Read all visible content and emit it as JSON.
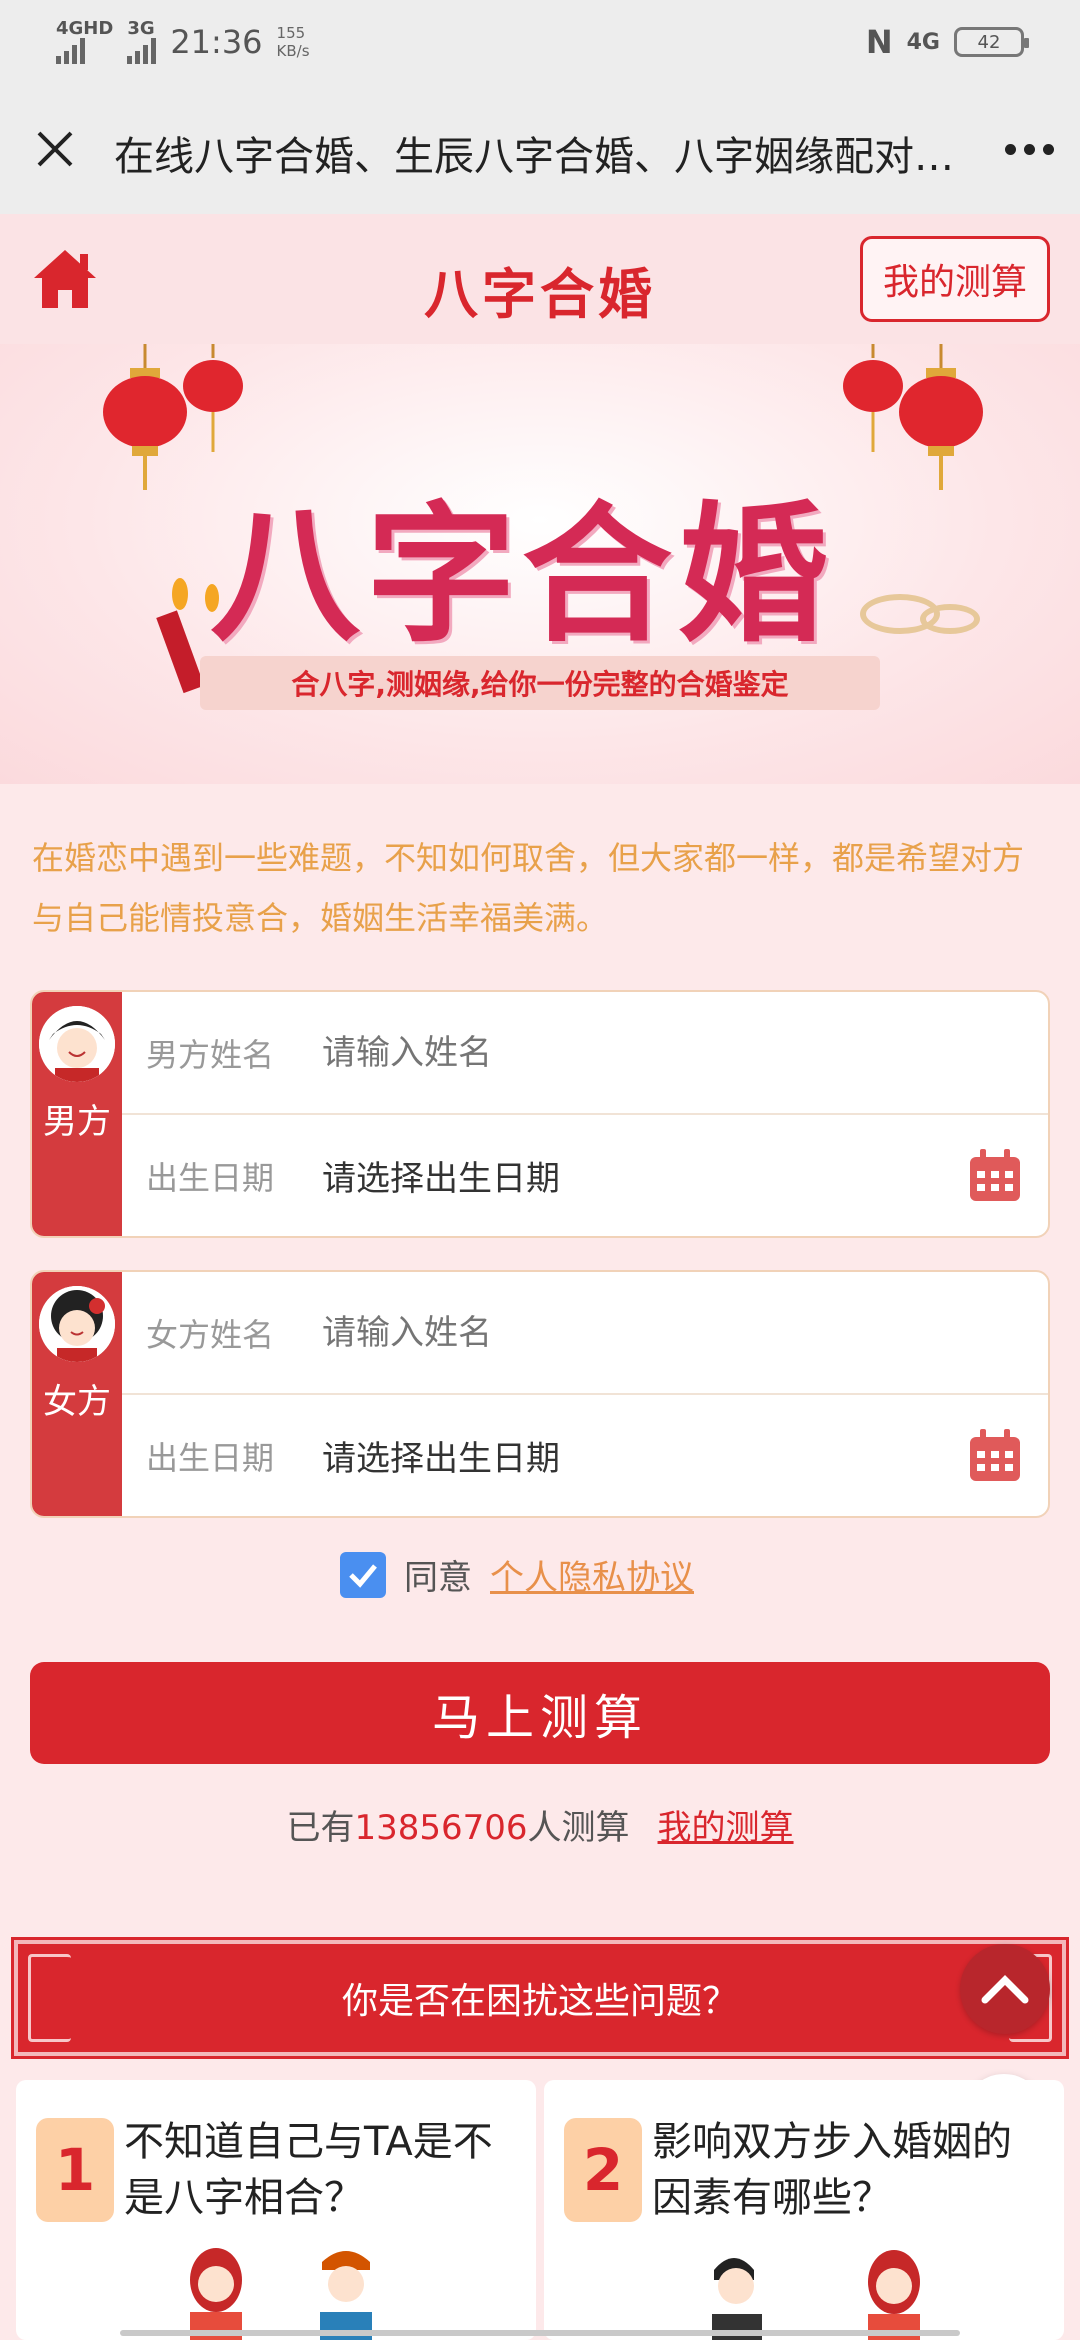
{
  "status_bar": {
    "network_1": "4GHD",
    "network_2": "3G",
    "time": "21:36",
    "speed_value": "155",
    "speed_unit": "KB/s",
    "nfc": "N",
    "network_right": "4G",
    "battery": "42"
  },
  "browser": {
    "title": "在线八字合婚、生辰八字合婚、八字姻缘配对…"
  },
  "header": {
    "title": "八字合婚",
    "my_calc": "我的测算"
  },
  "banner": {
    "title": "八字合婚",
    "subtitle": "合八字,测姻缘,给你一份完整的合婚鉴定"
  },
  "intro": "在婚恋中遇到一些难题，不知如何取舍，但大家都一样，都是希望对方与自己能情投意合，婚姻生活幸福美满。",
  "male": {
    "side_label": "男方",
    "name_label": "男方姓名",
    "name_placeholder": "请输入姓名",
    "birth_label": "出生日期",
    "birth_value": "请选择出生日期"
  },
  "female": {
    "side_label": "女方",
    "name_label": "女方姓名",
    "name_placeholder": "请输入姓名",
    "birth_label": "出生日期",
    "birth_value": "请选择出生日期"
  },
  "agreement": {
    "prefix": "同意",
    "link": "个人隐私协议",
    "checked": true
  },
  "submit": "马上测算",
  "count": {
    "prefix": "已有",
    "number": "13856706",
    "suffix": "人测算",
    "link": "我的测算"
  },
  "question_banner": "你是否在困扰这些问题？",
  "problems": [
    {
      "num": "1",
      "text": "不知道自己与TA是不是八字相合？"
    },
    {
      "num": "2",
      "text": "影响双方步入婚姻的因素有哪些？"
    }
  ],
  "colors": {
    "brand_red": "#d9262d",
    "accent_orange": "#e8a14a",
    "checkbox_blue": "#4a8ff0"
  }
}
